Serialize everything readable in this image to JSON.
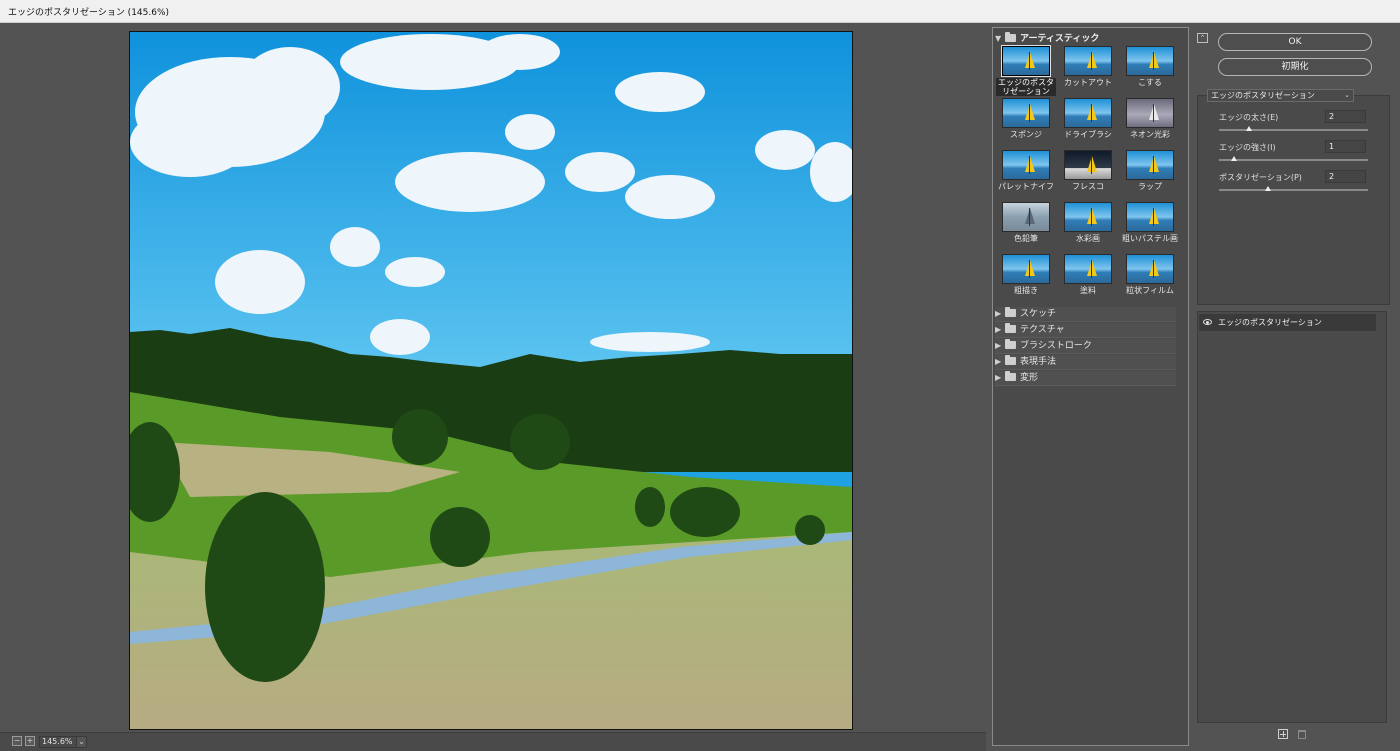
{
  "window": {
    "title": "エッジのポスタリゼーション (145.6%)"
  },
  "preview": {
    "zoom": "145.6%",
    "zoom_out_symbol": "−",
    "zoom_in_symbol": "+"
  },
  "gallery": {
    "open_category": "アーティスティック",
    "filters": [
      {
        "label": "エッジのポスタリゼーション",
        "selected": true
      },
      {
        "label": "カットアウト"
      },
      {
        "label": "こする"
      },
      {
        "label": "スポンジ"
      },
      {
        "label": "ドライブラシ"
      },
      {
        "label": "ネオン光彩"
      },
      {
        "label": "パレットナイフ"
      },
      {
        "label": "フレスコ"
      },
      {
        "label": "ラップ"
      },
      {
        "label": "色鉛筆"
      },
      {
        "label": "水彩画"
      },
      {
        "label": "粗いパステル画"
      },
      {
        "label": "粗描き"
      },
      {
        "label": "塗料"
      },
      {
        "label": "粒状フィルム"
      }
    ],
    "collapsed_categories": [
      "スケッチ",
      "テクスチャ",
      "ブラシストローク",
      "表現手法",
      "変形"
    ]
  },
  "actions": {
    "ok_label": "OK",
    "reset_label": "初期化"
  },
  "settings": {
    "selected_filter": "エッジのポスタリゼーション",
    "params": [
      {
        "label": "エッジの太さ(E)",
        "value": "2",
        "fraction": 0.2
      },
      {
        "label": "エッジの強さ(I)",
        "value": "1",
        "fraction": 0.1
      },
      {
        "label": "ポスタリゼーション(P)",
        "value": "2",
        "fraction": 0.33
      }
    ]
  },
  "layers": {
    "items": [
      {
        "name": "エッジのポスタリゼーション",
        "visible": true
      }
    ]
  },
  "colors": {
    "sky": "#1fa2e2",
    "grass": "#5a9a28",
    "forest": "#1b3d14",
    "panel": "#4a4a4a"
  }
}
